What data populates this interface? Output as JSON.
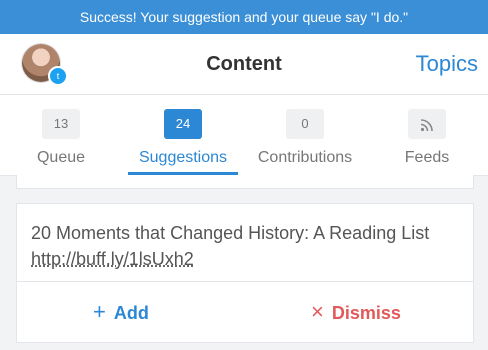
{
  "banner": {
    "text": "Success! Your suggestion and your queue say \"I do.\""
  },
  "header": {
    "title": "Content",
    "topics_label": "Topics"
  },
  "tabs": [
    {
      "count": "13",
      "label": "Queue"
    },
    {
      "count": "24",
      "label": "Suggestions",
      "active": true
    },
    {
      "count": "0",
      "label": "Contributions"
    },
    {
      "count": "rss-icon",
      "label": "Feeds"
    }
  ],
  "card": {
    "text": "20 Moments that Changed History: A Reading List ",
    "link": "http://buff.ly/1lsUxh2",
    "add_label": "Add",
    "dismiss_label": "Dismiss"
  },
  "colors": {
    "accent": "#2c87d4",
    "danger": "#e15a5a",
    "banner": "#3b8fd6"
  }
}
